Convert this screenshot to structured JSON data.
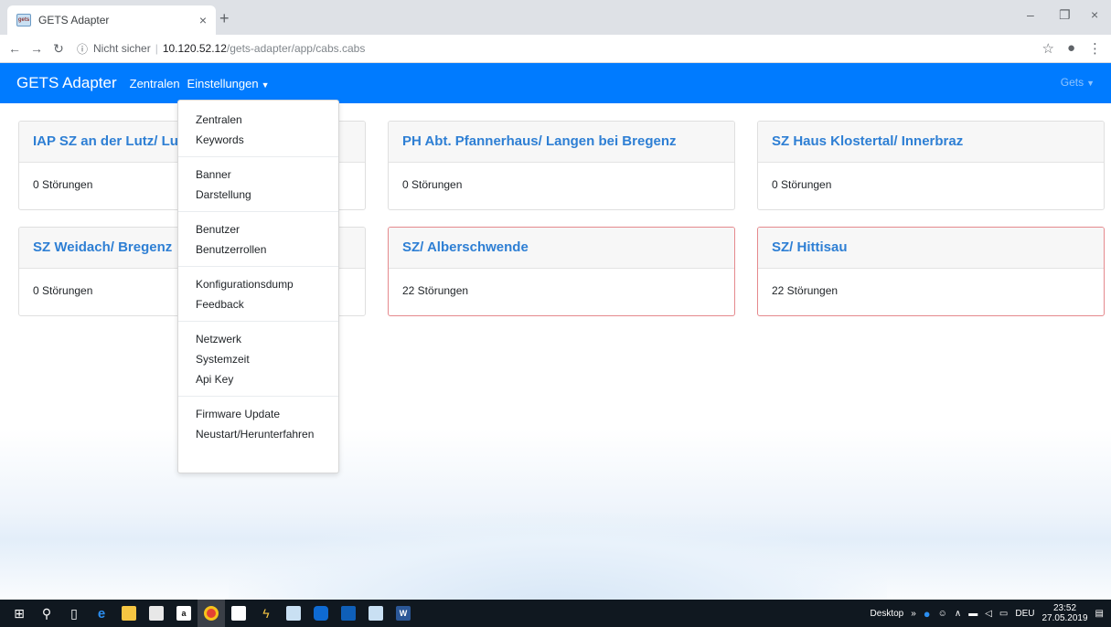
{
  "browser": {
    "tab_title": "GETS Adapter",
    "tab_favicon_text": "gets",
    "tab_close": "×",
    "new_tab": "+",
    "url_security": "Nicht sicher",
    "url_separator": "|",
    "url_host": "10.120.52.12",
    "url_path": "/gets-adapter/app/cabs.cabs",
    "window_minimize": "–",
    "window_maximize": "❐",
    "window_close": "×"
  },
  "navbar": {
    "brand": "GETS Adapter",
    "links": {
      "zentralen": "Zentralen",
      "einstellungen": "Einstellungen"
    },
    "user": "Gets"
  },
  "dropdown": {
    "groups": [
      [
        "Zentralen",
        "Keywords"
      ],
      [
        "Banner",
        "Darstellung"
      ],
      [
        "Benutzer",
        "Benutzerrollen"
      ],
      [
        "Konfigurationsdump",
        "Feedback"
      ],
      [
        "Netzwerk",
        "Systemzeit",
        "Api Key"
      ],
      [
        "Firmware Update",
        "Neustart/Herunterfahren"
      ]
    ]
  },
  "cards": [
    {
      "title": "IAP SZ an der Lutz/ Lu",
      "status": "0 Störungen"
    },
    {
      "title": "PH Abt. Pfannerhaus/ Langen bei Bregenz",
      "status": "0 Störungen"
    },
    {
      "title": "SZ Haus Klostertal/ Innerbraz",
      "status": "0 Störungen"
    },
    {
      "title": "SZ Weidach/ Bregenz",
      "status": "0 Störungen"
    },
    {
      "title": "SZ/ Alberschwende",
      "status": "22 Störungen"
    },
    {
      "title": "SZ/ Hittisau",
      "status": "22 Störungen"
    }
  ],
  "taskbar": {
    "desktop_label": "Desktop",
    "lang": "DEU",
    "time": "23:52",
    "date": "27.05.2019",
    "icons": [
      "windows-start-icon",
      "search-icon",
      "task-view-icon",
      "edge-icon",
      "file-explorer-icon",
      "store-icon",
      "amazon-icon",
      "chrome-icon",
      "mail-icon",
      "bolt-icon",
      "gets-app-icon",
      "teamviewer-icon",
      "outlook-icon",
      "gets-app-2-icon",
      "word-icon"
    ]
  },
  "colors": {
    "navbar": "#007bff",
    "card_title": "#2e7fd4",
    "alarm_border": "#e5898d"
  }
}
